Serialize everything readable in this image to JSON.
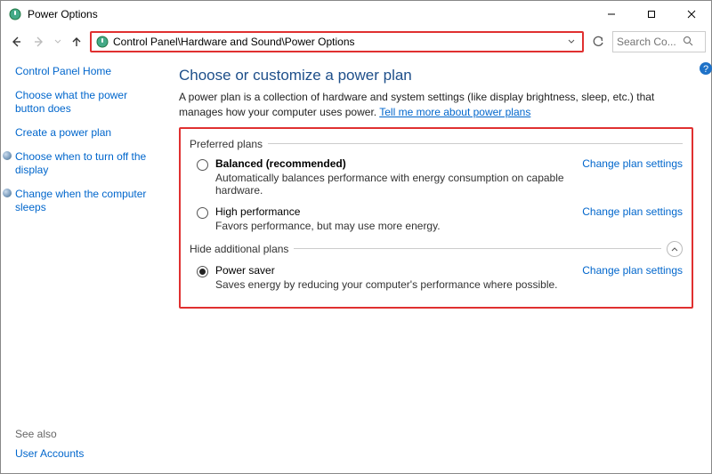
{
  "window": {
    "title": "Power Options"
  },
  "address_bar": {
    "path": "Control Panel\\Hardware and Sound\\Power Options"
  },
  "search": {
    "placeholder": "Search Co..."
  },
  "sidebar": {
    "links": [
      {
        "label": "Control Panel Home",
        "icon": false
      },
      {
        "label": "Choose what the power button does",
        "icon": false
      },
      {
        "label": "Create a power plan",
        "icon": false
      },
      {
        "label": "Choose when to turn off the display",
        "icon": true
      },
      {
        "label": "Change when the computer sleeps",
        "icon": true
      }
    ],
    "see_also_header": "See also",
    "see_also": [
      {
        "label": "User Accounts"
      }
    ]
  },
  "main": {
    "title": "Choose or customize a power plan",
    "desc_part1": "A power plan is a collection of hardware and system settings (like display brightness, sleep, etc.) that manages how your computer uses power. ",
    "more_link": "Tell me more about power plans",
    "preferred_header": "Preferred plans",
    "additional_header": "Hide additional plans",
    "change_label": "Change plan settings",
    "plans_preferred": [
      {
        "title": "Balanced (recommended)",
        "bold": true,
        "selected": false,
        "desc": "Automatically balances performance with energy consumption on capable hardware."
      },
      {
        "title": "High performance",
        "bold": false,
        "selected": false,
        "desc": "Favors performance, but may use more energy."
      }
    ],
    "plans_additional": [
      {
        "title": "Power saver",
        "bold": false,
        "selected": true,
        "desc": "Saves energy by reducing your computer's performance where possible."
      }
    ]
  }
}
